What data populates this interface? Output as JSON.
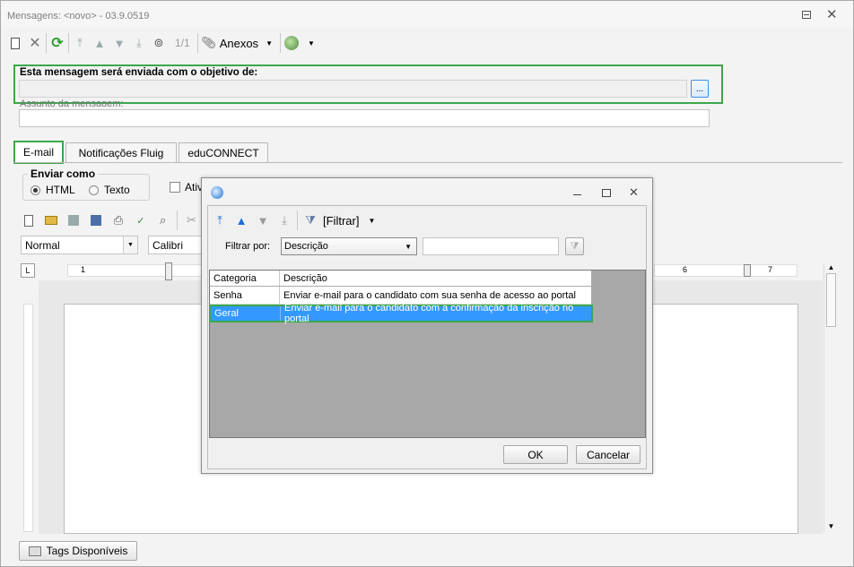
{
  "window": {
    "title": "Mensagens: <novo> - 03.9.0519"
  },
  "toolbar": {
    "record_counter": "1/1",
    "attachments_label": "Anexos"
  },
  "form": {
    "objective_label": "Esta mensagem será enviada com o objetivo de:",
    "objective_value": "",
    "lookup_button": "...",
    "subject_label": "Assunto da mensagem:",
    "subject_value": ""
  },
  "tabs": [
    {
      "label": "E-mail",
      "active": true
    },
    {
      "label": "Notificações Fluig"
    },
    {
      "label": "eduCONNECT"
    }
  ],
  "email": {
    "send_as_title": "Enviar como",
    "opt_html": "HTML",
    "opt_text": "Texto",
    "activate_label": "Ativ",
    "style_value": "Normal",
    "font_value": "Calibri",
    "ruler_numbers": [
      "1",
      "6",
      "7"
    ]
  },
  "dialog": {
    "filter_button": "[Filtrar]",
    "filter_by_label": "Filtrar por:",
    "filter_by_value": "Descrição",
    "filter_text": "",
    "columns": [
      "Categoria",
      "Descrição"
    ],
    "rows": [
      {
        "categoria": "Senha",
        "descricao": "Enviar e-mail para o candidato com sua senha de acesso ao portal",
        "selected": false
      },
      {
        "categoria": "Geral",
        "descricao": "Enviar e-mail para o candidato com a confirmação da inscrição no portal",
        "selected": true
      }
    ],
    "ok_label": "OK",
    "cancel_label": "Cancelar"
  },
  "footer": {
    "tags_button": "Tags Disponíveis"
  },
  "colors": {
    "highlight": "#3aa84c",
    "selection": "#3399ff",
    "accent_blue": "#1e6fd8"
  }
}
